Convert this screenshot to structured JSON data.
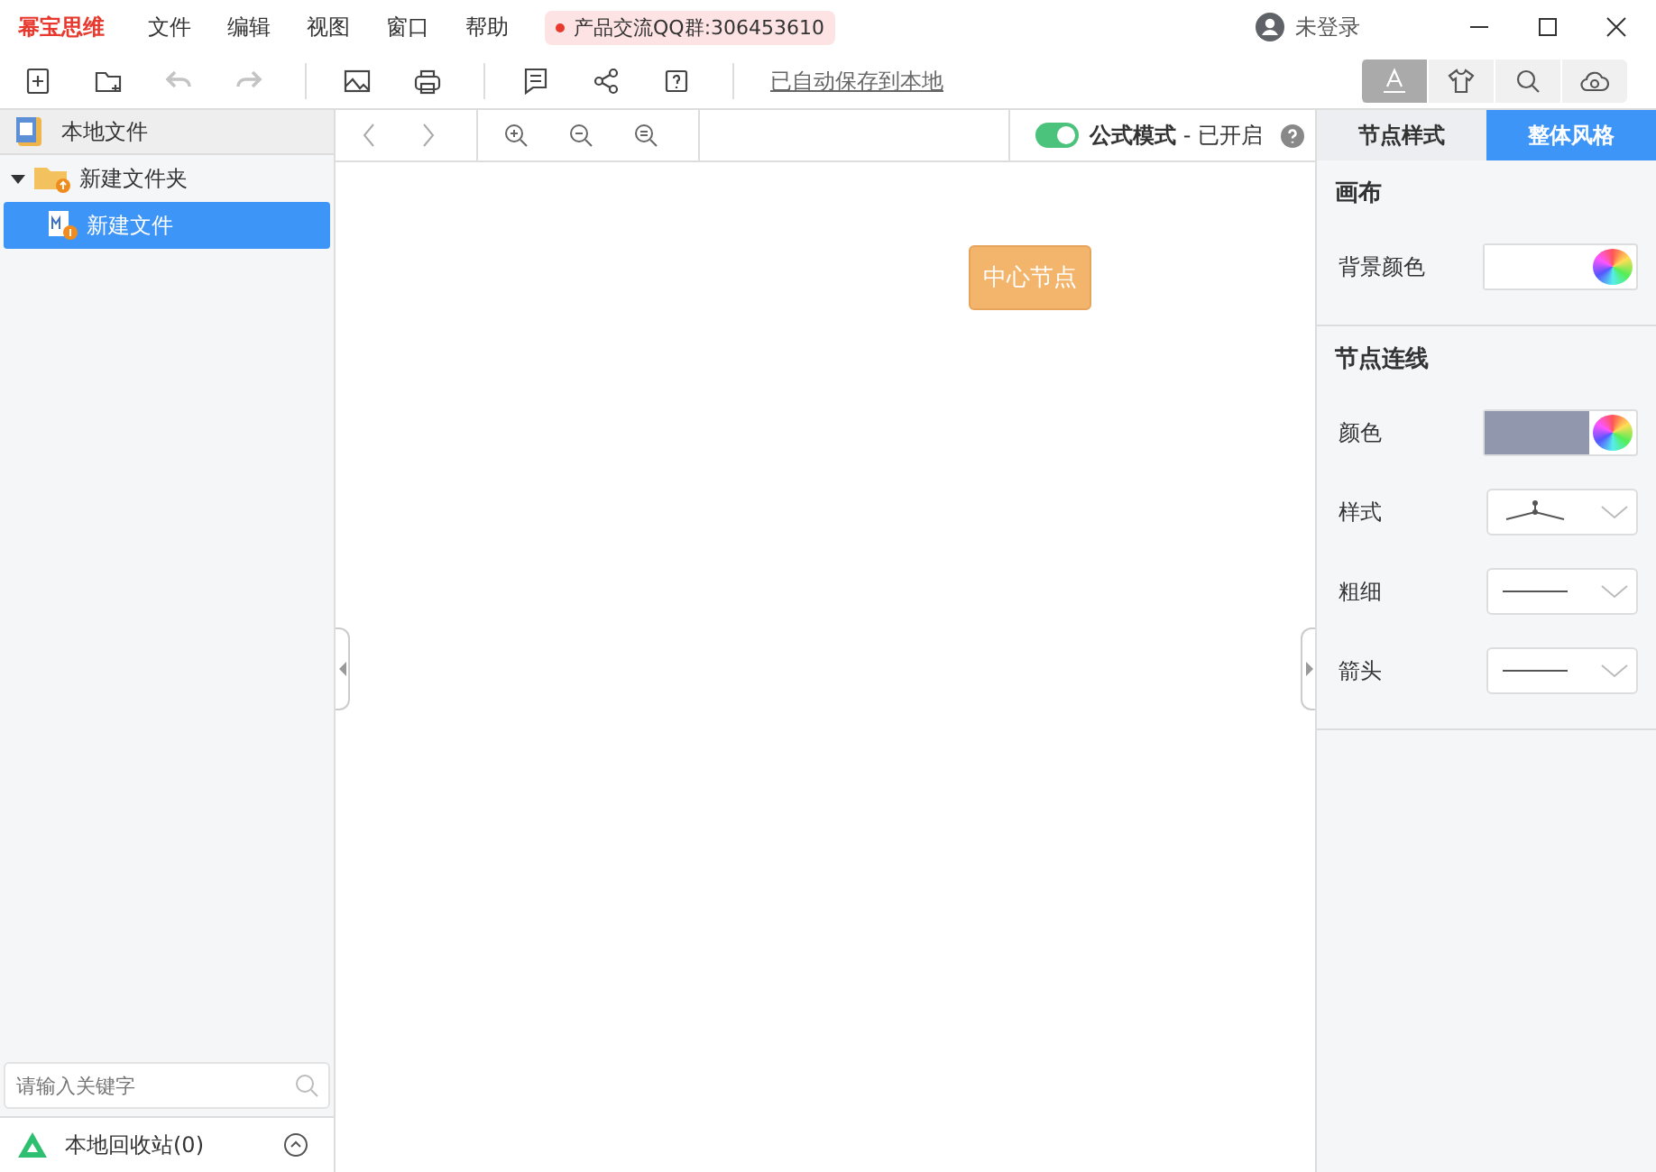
{
  "app_title": "幂宝思维",
  "menu": [
    "文件",
    "编辑",
    "视图",
    "窗口",
    "帮助"
  ],
  "notice": "产品交流QQ群:306453610",
  "user": "未登录",
  "toolbar": [
    {
      "items": [
        {
          "kind": "new-file",
          "disabled": false
        },
        {
          "kind": "new-folder",
          "disabled": false
        },
        {
          "kind": "undo",
          "disabled": true
        },
        {
          "kind": "redo",
          "disabled": true
        }
      ]
    },
    {
      "items": [
        {
          "kind": "image",
          "disabled": false
        },
        {
          "kind": "print",
          "disabled": false
        }
      ]
    },
    {
      "items": [
        {
          "kind": "comment",
          "disabled": false
        },
        {
          "kind": "share",
          "disabled": false
        },
        {
          "kind": "help",
          "disabled": false
        }
      ]
    }
  ],
  "autosave_link": "已自动保存到本地",
  "right_tools": [
    {
      "kind": "text",
      "selected": true
    },
    {
      "kind": "shirt",
      "selected": false
    },
    {
      "kind": "search",
      "selected": false
    },
    {
      "kind": "cloud",
      "selected": false
    }
  ],
  "sidebar": {
    "header": "本地文件",
    "tree": [
      {
        "label": "新建文件夹",
        "expanded": true,
        "selected": false,
        "children": [
          {
            "label": "新建文件",
            "selected": true
          }
        ]
      }
    ],
    "search": {
      "placeholder": "请输入关键字"
    },
    "recycle": "本地回收站(0)"
  },
  "canvas": {
    "formula": {
      "on": true,
      "label": "公式模式",
      "status": "- 已开启"
    },
    "node": "中心节点"
  },
  "panel": {
    "tabs": [
      {
        "label": "节点样式",
        "selected": false
      },
      {
        "label": "整体风格",
        "selected": true
      }
    ],
    "sections": [
      {
        "title": "画布",
        "rows": [
          {
            "kind": "color",
            "label": "背景颜色",
            "color": "#ffffff"
          }
        ]
      },
      {
        "title": "节点连线",
        "rows": [
          {
            "kind": "color",
            "label": "颜色",
            "color": "#9198ae"
          },
          {
            "kind": "style",
            "label": "样式"
          },
          {
            "kind": "line",
            "label": "粗细"
          },
          {
            "kind": "line",
            "label": "箭头"
          }
        ]
      }
    ]
  }
}
